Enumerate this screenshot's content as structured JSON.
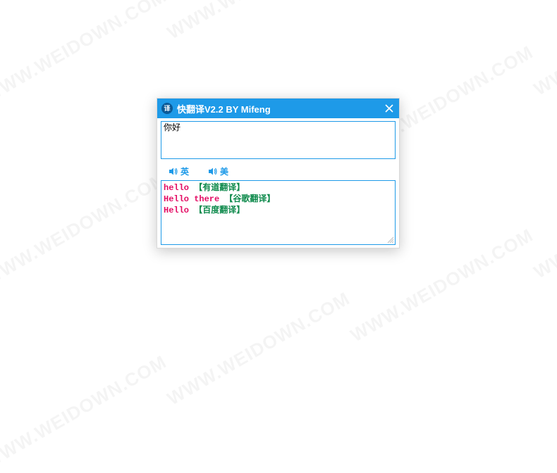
{
  "watermark_text": "WWW.WEIDOWN.COM",
  "titlebar": {
    "icon_char": "译",
    "title": "快翻译V2.2 BY Mifeng"
  },
  "input": {
    "value": "你好"
  },
  "audio": {
    "british_label": "英",
    "american_label": "美"
  },
  "results": [
    {
      "translation": "hello",
      "source": "【有道翻译】"
    },
    {
      "translation": "Hello there",
      "source": "【谷歌翻译】"
    },
    {
      "translation": "Hello",
      "source": "【百度翻译】"
    }
  ]
}
